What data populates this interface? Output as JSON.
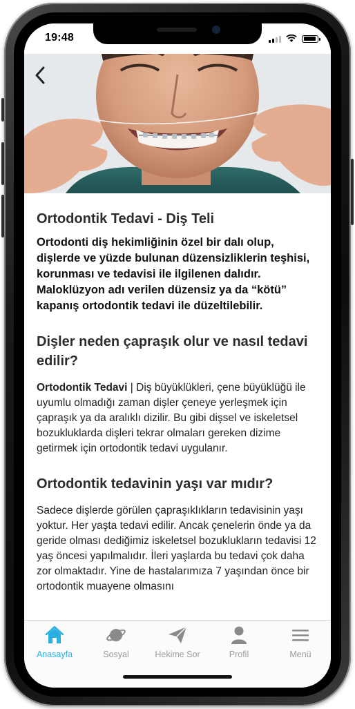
{
  "status_bar": {
    "time": "19:48"
  },
  "nav": {
    "back_icon": "chevron-left-icon"
  },
  "article": {
    "title": "Ortodontik Tedavi - Diş Teli",
    "intro": "Ortodonti diş hekimliğinin özel bir dalı olup, dişlerde ve yüzde bulunan düzensizliklerin teşhisi, korunması ve tedavisi ile ilgilenen dalıdır. Maloklüzyon adı verilen düzensiz ya da “kötü” kapanış ortodontik tedavi ile düzeltilebilir.",
    "section1_title": "Dişler neden çapraşık olur ve nasıl tedavi edilir?",
    "section1_bold": "Ortodontik Tedavi",
    "section1_text": " | Diş büyüklükleri, çene büyüklüğü ile uyumlu olmadığı zaman dişler çeneye yerleşmek için çapraşık ya da aralıklı dizilir. Bu gibi dişsel ve iskeletsel bozukluklarda dişleri tekrar olmaları gereken dizime getirmek için ortodontik tedavi uygulanır.",
    "section2_title": "Ortodontik tedavinin yaşı var mıdır?",
    "section2_text": "Sadece dişlerde görülen çapraşıklıkların tedavisinin yaşı yoktur. Her yaşta tedavi edilir. Ancak çenelerin önde ya da geride olması dediğimiz iskeletsel bozuklukların tedavisi 12 yaş öncesi yapılmalıdır. İleri yaşlarda bu tedavi çok daha zor olmaktadır. Yine de hastalarımıza 7 yaşından önce bir ortodontik muayene olmasını"
  },
  "tabs": [
    {
      "label": "Anasayfa",
      "icon": "home-icon",
      "active": true
    },
    {
      "label": "Sosyal",
      "icon": "planet-icon",
      "active": false
    },
    {
      "label": "Hekime Sor",
      "icon": "paper-plane-icon",
      "active": false
    },
    {
      "label": "Profil",
      "icon": "person-icon",
      "active": false
    },
    {
      "label": "Menü",
      "icon": "menu-icon",
      "active": false
    }
  ],
  "colors": {
    "accent": "#2ab0e0",
    "inactive": "#9a9a9a"
  }
}
